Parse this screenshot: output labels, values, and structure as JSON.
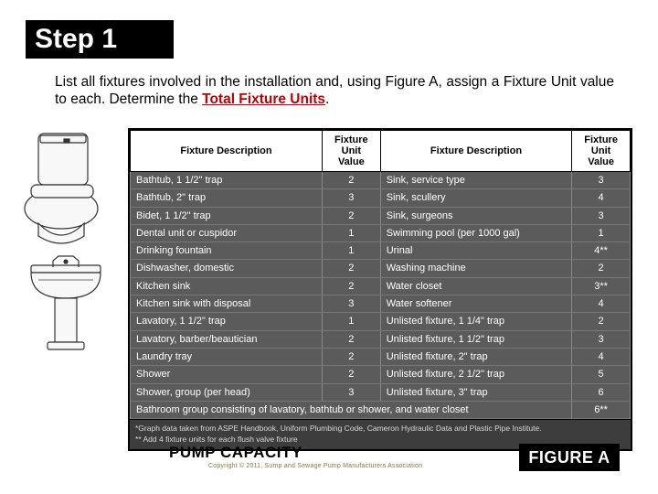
{
  "step_label": "Step 1",
  "intro_pre": "List all fixtures involved in the installation and, using Figure A, assign a Fixture Unit value to each.  Determine the ",
  "intro_red": "Total Fixture Units",
  "intro_post": ".",
  "headers": {
    "desc": "Fixture Description",
    "val": "Fixture\nUnit Value"
  },
  "rows": [
    {
      "l_desc": "Bathtub, 1 1/2\" trap",
      "l_val": "2",
      "r_desc": "Sink, service type",
      "r_val": "3"
    },
    {
      "l_desc": "Bathtub, 2\" trap",
      "l_val": "3",
      "r_desc": "Sink, scullery",
      "r_val": "4"
    },
    {
      "l_desc": "Bidet, 1 1/2\" trap",
      "l_val": "2",
      "r_desc": "Sink, surgeons",
      "r_val": "3"
    },
    {
      "l_desc": "Dental unit or cuspidor",
      "l_val": "1",
      "r_desc": "Swimming pool (per 1000 gal)",
      "r_val": "1"
    },
    {
      "l_desc": "Drinking fountain",
      "l_val": "1",
      "r_desc": "Urinal",
      "r_val": "4**"
    },
    {
      "l_desc": "Dishwasher, domestic",
      "l_val": "2",
      "r_desc": "Washing machine",
      "r_val": "2"
    },
    {
      "l_desc": "Kitchen sink",
      "l_val": "2",
      "r_desc": "Water closet",
      "r_val": "3**"
    },
    {
      "l_desc": "Kitchen sink with disposal",
      "l_val": "3",
      "r_desc": "Water softener",
      "r_val": "4"
    },
    {
      "l_desc": "Lavatory, 1 1/2\" trap",
      "l_val": "1",
      "r_desc": "Unlisted fixture, 1 1/4\" trap",
      "r_val": "2"
    },
    {
      "l_desc": "Lavatory, barber/beautician",
      "l_val": "2",
      "r_desc": "Unlisted fixture, 1 1/2\" trap",
      "r_val": "3"
    },
    {
      "l_desc": "Laundry tray",
      "l_val": "2",
      "r_desc": "Unlisted fixture, 2\" trap",
      "r_val": "4"
    },
    {
      "l_desc": "Shower",
      "l_val": "2",
      "r_desc": "Unlisted fixture, 2 1/2\" trap",
      "r_val": "5"
    },
    {
      "l_desc": "Shower, group (per head)",
      "l_val": "3",
      "r_desc": "Unlisted fixture, 3\" trap",
      "r_val": "6"
    }
  ],
  "span_row": {
    "desc": "Bathroom group consisting of lavatory, bathtub or shower, and water closet",
    "val": "6**"
  },
  "footnote1": "*Graph data taken from ASPE Handbook, Uniform Plumbing Code, Cameron Hydraulic Data and Plastic Pipe Institute.",
  "footnote2": "** Add 4 fixture units for each flush valve fixture",
  "bottom_title": "PUMP CAPACITY",
  "copyright": "Copyright © 2011, Sump and Sewage Pump Manufacturers Association",
  "figure_label": "FIGURE A"
}
